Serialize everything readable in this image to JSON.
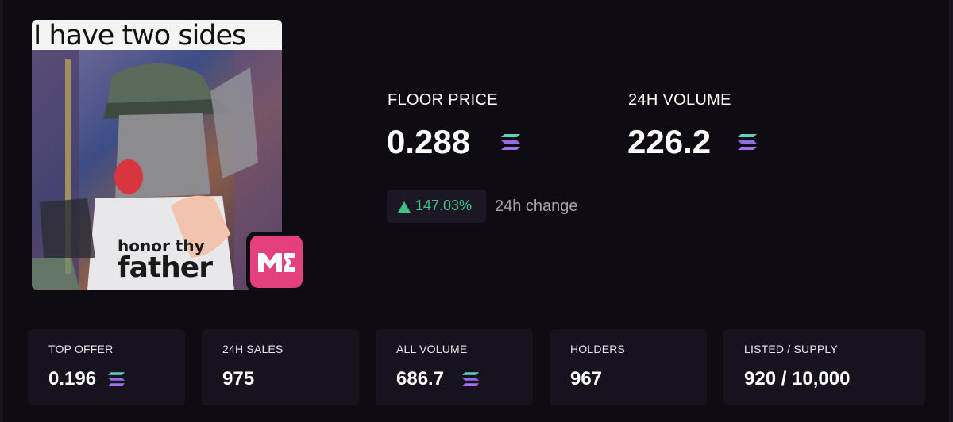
{
  "collection": {
    "image_caption": "I have two sides",
    "shirt_line_1": "honor thy",
    "shirt_line_2": "father",
    "marketplace_badge_icon": "magic-eden-icon",
    "badge_color": "#e4407e"
  },
  "floor_price": {
    "label": "FLOOR PRICE",
    "value": "0.288",
    "currency_icon": "solana-icon"
  },
  "volume_24h": {
    "label": "24H VOLUME",
    "value": "226.2",
    "currency_icon": "solana-icon"
  },
  "change": {
    "arrow_icon": "up-triangle-icon",
    "percent": "147.03%",
    "label": "24h change",
    "color": "#3ec28a"
  },
  "cards": [
    {
      "label": "TOP OFFER",
      "value": "0.196",
      "currency_icon": "solana-icon"
    },
    {
      "label": "24H SALES",
      "value": "975"
    },
    {
      "label": "ALL VOLUME",
      "value": "686.7",
      "currency_icon": "solana-icon"
    },
    {
      "label": "HOLDERS",
      "value": "967"
    },
    {
      "label": "LISTED / SUPPLY",
      "value": "920 / 10,000"
    }
  ]
}
